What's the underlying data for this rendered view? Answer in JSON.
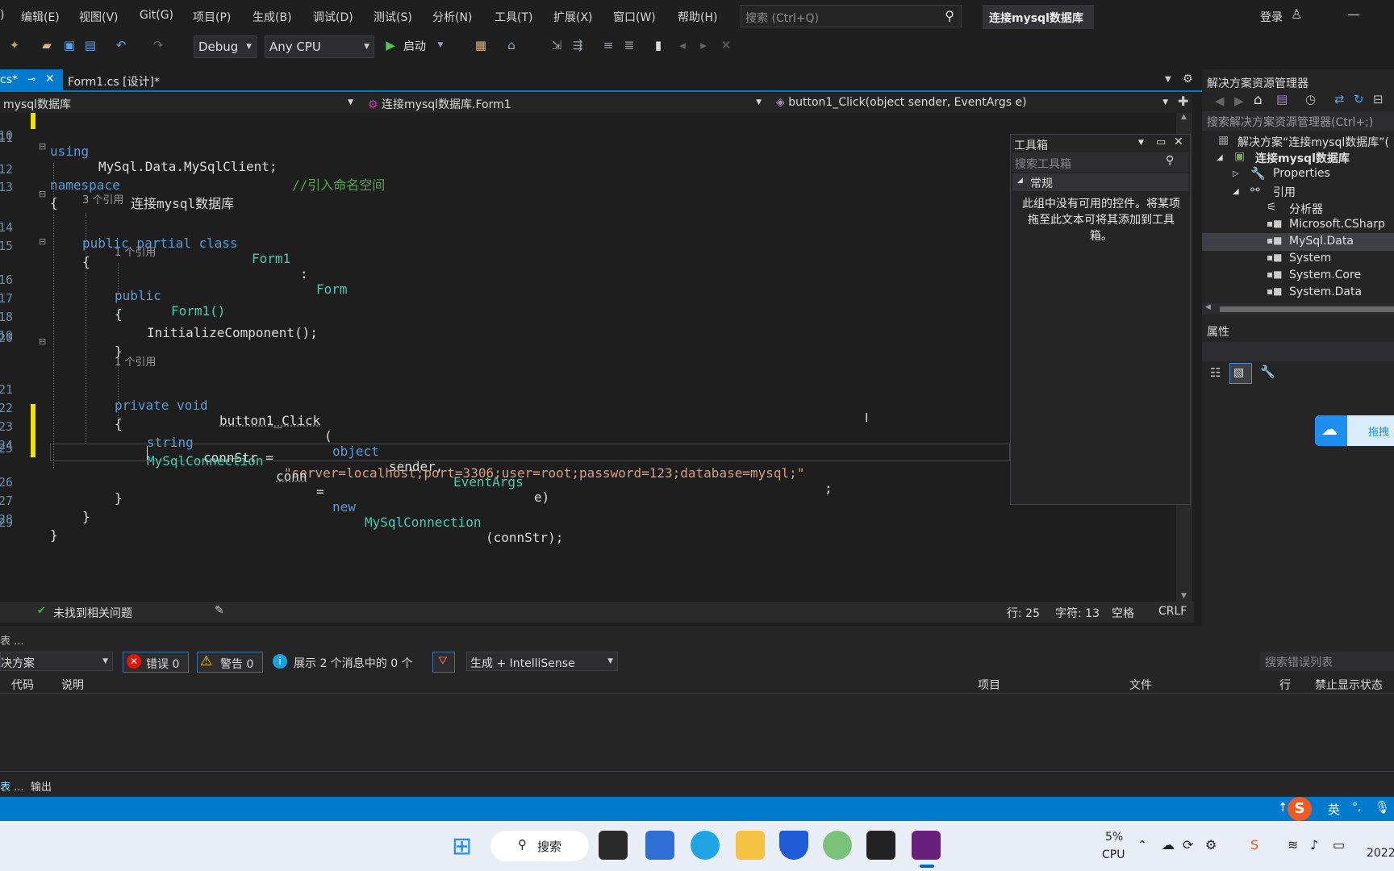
{
  "menu": [
    "编辑(E)",
    "视图(V)",
    "Git(G)",
    "项目(P)",
    "生成(B)",
    "调试(D)",
    "测试(S)",
    "分析(N)",
    "工具(T)",
    "扩展(X)",
    "窗口(W)",
    "帮助(H)"
  ],
  "search": {
    "placeholder": "搜索 (Ctrl+Q)"
  },
  "window_title": "连接mysql数据库",
  "login": "登录",
  "toolbar": {
    "config": "Debug",
    "platform": "Any CPU",
    "start": "启动"
  },
  "tabs": {
    "tab1": "cs*",
    "tab2": "Form1.cs [设计]*"
  },
  "nav": {
    "project": "mysql数据库",
    "class": "连接mysql数据库.Form1",
    "member": "button1_Click(object sender, EventArgs e)"
  },
  "code": {
    "l10": "10",
    "l11": "11",
    "l12": "12",
    "l13": "13",
    "l14": "14",
    "l15": "15",
    "l16": "16",
    "l17": "17",
    "l18": "18",
    "l19": "19",
    "l20": "20",
    "l21": "21",
    "l22": "22",
    "l23": "23",
    "l24": "24",
    "l25": "25",
    "l26": "26",
    "l27": "27",
    "l28": "28",
    "l29": "29",
    "using_kw": "using",
    "using_ns": "MySql.Data.MySqlClient;",
    "comment": "//引入命名空间",
    "ns_kw": "namespace",
    "ns_name": "连接mysql数据库",
    "lens3": "3 个引用",
    "lens1a": "1 个引用",
    "lens1b": "1 个引用",
    "class_decl_kw": "public partial class",
    "class_name": "Form1",
    "colon": ":",
    "base": "Form",
    "ctor_kw": "public",
    "ctor_name": "Form1()",
    "init": "InitializeComponent();",
    "method_kw": "private void",
    "method_name": "button1_Click",
    "paren_open": "(",
    "p_obj": "object",
    "p_sender": "sender,",
    "p_args": "EventArgs",
    "p_e": "e)",
    "str_kw": "string",
    "conn_var": "connStr =",
    "conn_val": "\"server=localhost;port=3306;user=root;password=123;database=mysql;\"",
    "semi": ";",
    "mc_type": "MySqlConnection",
    "mc_var": "conn",
    "mc_eq": "=",
    "mc_new": "new",
    "mc_type2": "MySqlConnection",
    "mc_args": "(connStr);",
    "brace_open": "{",
    "brace_close": "}"
  },
  "toolbox": {
    "title": "工具箱",
    "search": "搜索工具箱",
    "group": "常规",
    "empty": "此组中没有可用的控件。将某项拖至此文本可将其添加到工具箱。"
  },
  "status": {
    "issues": "未找到相关问题",
    "row": "行: 25",
    "col": "字符: 13",
    "space": "空格",
    "eol": "CRLF"
  },
  "solution": {
    "title": "解决方案资源管理器",
    "search": "搜索解决方案资源管理器(Ctrl+;)",
    "items": [
      "解决方案“连接mysql数据库”(",
      "连接mysql数据库",
      "Properties",
      "引用",
      "分析器",
      "Microsoft.CSharp",
      "MySql.Data",
      "System",
      "System.Core",
      "System.Data"
    ]
  },
  "properties": {
    "title": "属性"
  },
  "cloud": "拖拽",
  "errorlist": {
    "header": "表 ...",
    "scope": "决方案",
    "errors": "错误 0",
    "warnings": "警告 0",
    "messages": "展示 2 个消息中的 0 个",
    "build": "生成 + IntelliSense",
    "search": "搜索错误列表",
    "cols": [
      "代码",
      "说明",
      "项目",
      "文件",
      "行",
      "禁止显示状态"
    ],
    "bottom_tabs": [
      "表 ...",
      "输出"
    ]
  },
  "bluebar": {
    "ime": "英"
  },
  "taskbar": {
    "search": "搜索",
    "cpu_pct": "5%",
    "cpu": "CPU",
    "time": "2022"
  },
  "colors": {
    "accent": "#007acc",
    "keyword": "#569cd6",
    "type": "#4ec9b0",
    "string": "#d69d85",
    "comment": "#57a64a"
  }
}
